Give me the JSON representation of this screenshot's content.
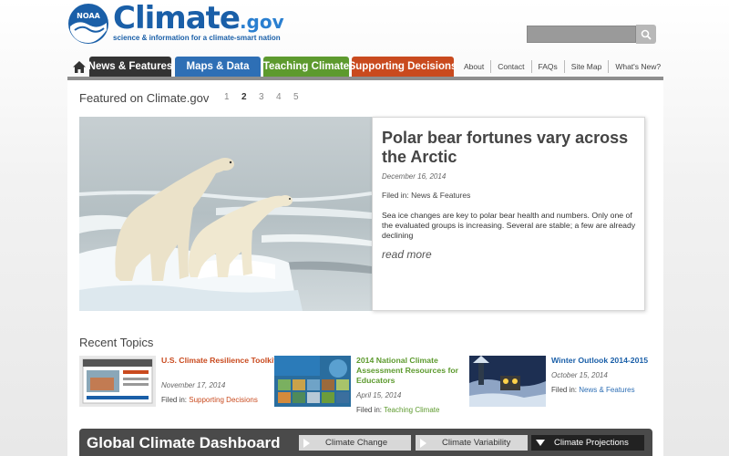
{
  "brand": {
    "seal_text": "NOAA",
    "wordmark": "Climate",
    "domain_suffix": ".gov",
    "tagline": "science & information for a climate-smart nation"
  },
  "search": {
    "placeholder": "",
    "icon": "search-icon"
  },
  "nav": {
    "home_icon": "home-icon",
    "tabs": [
      {
        "label": "News & Features",
        "color": "#333333"
      },
      {
        "label": "Maps & Data",
        "color": "#2e6fb5"
      },
      {
        "label": "Teaching Climate",
        "color": "#5d9a2e"
      },
      {
        "label": "Supporting Decisions",
        "color": "#c94a1e"
      }
    ],
    "utility": [
      "About",
      "Contact",
      "FAQs",
      "Site Map",
      "What's New?"
    ]
  },
  "featured": {
    "heading": "Featured on Climate.gov",
    "pages": [
      "1",
      "2",
      "3",
      "4",
      "5"
    ],
    "current_page": "2",
    "headline": "Polar bear fortunes vary across the Arctic",
    "date": "December 16, 2014",
    "filed_prefix": "Filed in:",
    "filed_in": "News & Features",
    "description": "Sea ice changes are key to polar bear health and numbers.  Only one of the evaluated groups is increasing. Several are stable; a few are already declining",
    "read_more": "read more"
  },
  "recent": {
    "heading": "Recent Topics",
    "items": [
      {
        "title": "U.S. Climate Resilience Toolkit",
        "date": "November 17, 2014",
        "filed_prefix": "Filed in:",
        "filed_in": "Supporting Decisions",
        "color": "#c94a1e"
      },
      {
        "title": "2014 National Climate Assessment Resources for Educators",
        "date": "April 15, 2014",
        "filed_prefix": "Filed in:",
        "filed_in": "Teaching Climate",
        "color": "#5d9a2e"
      },
      {
        "title": "Winter Outlook 2014-2015",
        "date": "October 15, 2014",
        "filed_prefix": "Filed in:",
        "filed_in": "News & Features",
        "color": "#2e6fb5"
      }
    ]
  },
  "dashboard": {
    "title": "Global Climate Dashboard",
    "tabs": [
      "Climate Change",
      "Climate Variability",
      "Climate Projections"
    ],
    "active_tab": "Climate Projections"
  }
}
